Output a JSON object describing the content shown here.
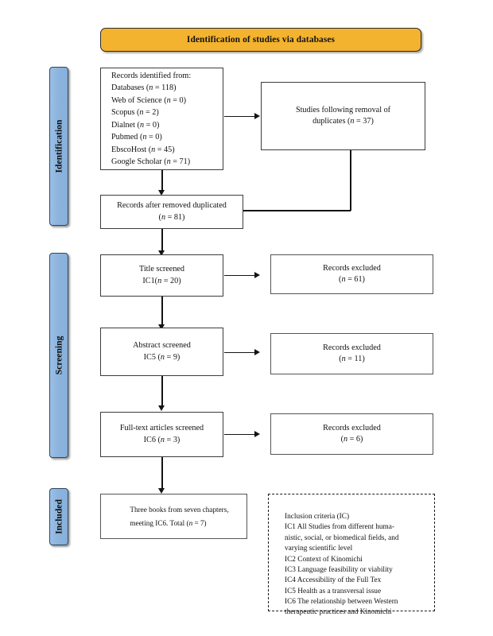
{
  "diagram": {
    "title": "Identification of studies via databases",
    "phases": [
      {
        "key": "identification",
        "label": "Identification"
      },
      {
        "key": "screening",
        "label": "Screening"
      },
      {
        "key": "included",
        "label": "Included"
      }
    ],
    "boxes": {
      "records_identified": {
        "text": "Records identified from:\nDatabases (n = 118)\nWeb of Science (n = 0)\nScopus (n = 2)\nDialnet (n = 0)\nPubmed (n = 0)\nEbscoHost (n = 45)\nGoogle Scholar (n = 71)"
      },
      "duplicates_removed": {
        "text": "Studies following removal of\nduplicates (n = 37)"
      },
      "records_after_duplicates": {
        "text": "Records after removed duplicated\n(n = 81)"
      },
      "title_screened": {
        "text": "Title screened\nIC1(n = 20)"
      },
      "excluded_title": {
        "text": "Records excluded\n(n = 61)"
      },
      "abstract_screened": {
        "text": "Abstract screened\nIC5 (n = 9)"
      },
      "excluded_abstract": {
        "text": "Records excluded\n(n = 11)"
      },
      "fulltext_screened": {
        "text": "Full-text articles screened\nIC6 (n = 3)"
      },
      "excluded_fulltext": {
        "text": "Records excluded\n(n = 6)"
      },
      "included_result": {
        "text": "Three books from seven chapters,\nmeeting IC6. Total (n = 7)"
      }
    },
    "inclusion_criteria": {
      "heading": "Inclusion criteria (IC)",
      "items": [
        "IC1 All Studies from different huma-\nnistic, social, or biomedical fields, and\nvarying scientific level",
        "IC2 Context of Kinomichi",
        "IC3 Language feasibility or viability",
        "IC4 Accessibility of the Full Tex",
        "IC5 Health as a transversal issue",
        "IC6 The relationship between Western\ntherapeutic practices and Kinomichi"
      ]
    },
    "colors": {
      "header_band": "#F4B32E",
      "phase_band": "#8CB4DD",
      "box_border": "#3C3C3C",
      "connector": "#141414",
      "background": "#FFFFFF"
    }
  }
}
